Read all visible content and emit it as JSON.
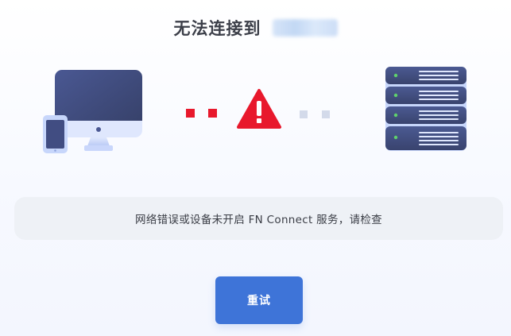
{
  "header": {
    "title": "无法连接到"
  },
  "message": {
    "text": "网络错误或设备未开启 FN Connect 服务，请检查"
  },
  "actions": {
    "retry_label": "重试"
  },
  "icons": {
    "client": "computer-and-phone-icon",
    "warning": "warning-triangle-icon",
    "server": "server-rack-icon"
  },
  "colors": {
    "accent": "#3e74d8",
    "error": "#e8182c",
    "device_dark": "#3b4573",
    "device_light": "#c7d6fb"
  }
}
